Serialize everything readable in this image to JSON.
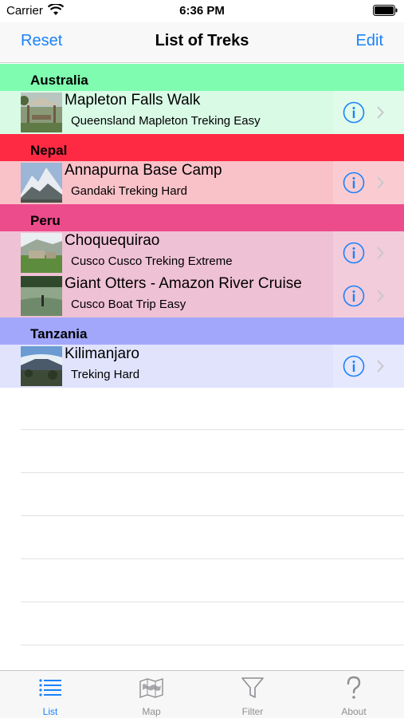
{
  "status_bar": {
    "carrier": "Carrier",
    "time": "6:36 PM"
  },
  "nav": {
    "left_button": "Reset",
    "title": "List of Treks",
    "right_button": "Edit"
  },
  "sections": [
    {
      "name": "Australia",
      "header_color": "#7ffcb0",
      "row_color": "#d9fbe6",
      "rows": [
        {
          "title": "Mapleton Falls Walk",
          "subtitle": "Queensland Mapleton Treking Easy",
          "image_icon": "picnic-shelter-photo"
        }
      ]
    },
    {
      "name": "Nepal",
      "header_color": "#fe2a44",
      "row_color": "#f9c1c8",
      "rows": [
        {
          "title": "Annapurna Base Camp",
          "subtitle": "Gandaki Treking Hard",
          "image_icon": "snowy-mountain-photo"
        }
      ]
    },
    {
      "name": "Peru",
      "header_color": "#ec4c8c",
      "row_color": "#efc1d4",
      "rows": [
        {
          "title": "Choquequirao",
          "subtitle": "Cusco Cusco Treking Extreme",
          "image_icon": "ruins-photo"
        },
        {
          "title": "Giant Otters - Amazon River Cruise",
          "subtitle": "Cusco Boat Trip Easy",
          "image_icon": "river-photo"
        }
      ]
    },
    {
      "name": "Tanzania",
      "header_color": "#a2a7fc",
      "row_color": "#e1e3fd",
      "rows": [
        {
          "title": "Kilimanjaro",
          "subtitle": "Treking Hard",
          "image_icon": "mountain-plain-photo"
        }
      ]
    }
  ],
  "tabs": [
    {
      "label": "List",
      "icon": "list-icon",
      "active": true
    },
    {
      "label": "Map",
      "icon": "map-icon",
      "active": false
    },
    {
      "label": "Filter",
      "icon": "filter-icon",
      "active": false
    },
    {
      "label": "About",
      "icon": "question-icon",
      "active": false
    }
  ],
  "colors": {
    "accent": "#1a82fb",
    "tab_inactive": "#8e8e93"
  }
}
